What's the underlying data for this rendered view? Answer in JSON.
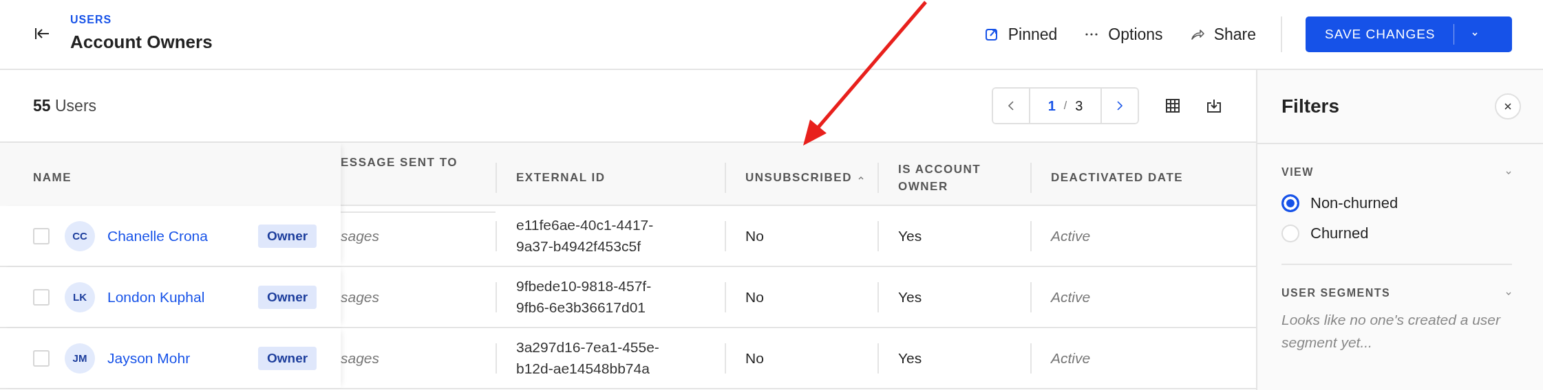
{
  "header": {
    "breadcrumb": "USERS",
    "title": "Account Owners",
    "actions": [
      {
        "kind": "pin",
        "label": "Pinned"
      },
      {
        "kind": "more",
        "label": "Options"
      },
      {
        "kind": "share",
        "label": "Share"
      }
    ],
    "save_button": "SAVE CHANGES"
  },
  "summary": {
    "count": "55",
    "label": "Users"
  },
  "pager": {
    "current": "1",
    "separator": "/",
    "total": "3"
  },
  "table": {
    "columns": [
      {
        "label": "NAME",
        "sorted": false
      },
      {
        "label": "ESSAGE SENT TO",
        "sorted": false
      },
      {
        "label": "EXTERNAL ID",
        "sorted": false
      },
      {
        "label": "UNSUBSCRIBED",
        "sorted": true
      },
      {
        "label": "IS ACCOUNT OWNER",
        "sorted": false
      },
      {
        "label": "DEACTIVATED DATE",
        "sorted": false
      }
    ],
    "rows": [
      {
        "checked": false,
        "initials": "CC",
        "name": "Chanelle Crona",
        "badge": "Owner",
        "message": "sages",
        "external_id": "e11fe6ae-40c1-4417-9a37-b4942f453c5f",
        "unsubscribed": "No",
        "is_owner": "Yes",
        "deactivated": "Active"
      },
      {
        "checked": false,
        "initials": "LK",
        "name": "London Kuphal",
        "badge": "Owner",
        "message": "sages",
        "external_id": "9fbede10-9818-457f-9fb6-6e3b36617d01",
        "unsubscribed": "No",
        "is_owner": "Yes",
        "deactivated": "Active"
      },
      {
        "checked": false,
        "initials": "JM",
        "name": "Jayson Mohr",
        "badge": "Owner",
        "message": "sages",
        "external_id": "3a297d16-7ea1-455e-b12d-ae14548bb74a",
        "unsubscribed": "No",
        "is_owner": "Yes",
        "deactivated": "Active"
      }
    ]
  },
  "filters": {
    "title": "Filters",
    "sections": [
      {
        "title": "VIEW",
        "expanded": true,
        "options": [
          {
            "label": "Non-churned",
            "selected": true
          },
          {
            "label": "Churned",
            "selected": false
          }
        ]
      },
      {
        "title": "USER SEGMENTS",
        "expanded": true,
        "note": "Looks like no one's created a user segment yet..."
      }
    ]
  }
}
